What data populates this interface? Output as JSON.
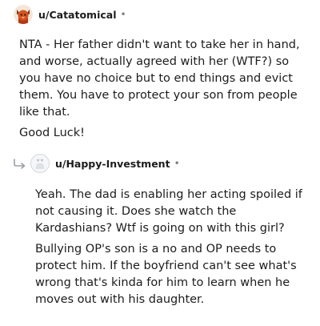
{
  "comments": [
    {
      "username": "u/Catatomical",
      "separator": "•",
      "avatar_icon": "fox-avatar-icon",
      "paragraphs": [
        "NTA - Her father didn't want to take her in hand, and worse, actually agreed with her (WTF?) so you have no choice but to end things and evict them. You have to protect your son from people like that.",
        "Good Luck!"
      ]
    },
    {
      "username": "u/Happy-Investment",
      "separator": "•",
      "avatar_icon": "default-avatar-icon",
      "reply_icon": "reply-arrow-icon",
      "paragraphs": [
        "Yeah. The dad is enabling her acting spoiled if not causing it. Does she watch the Kardashians? Wtf is going on with this girl?",
        "Bullying OP's son is a no and OP needs to protect him. If the boyfriend can't see what's wrong that's kinda for him to learn when he moves out with his daughter."
      ]
    }
  ]
}
